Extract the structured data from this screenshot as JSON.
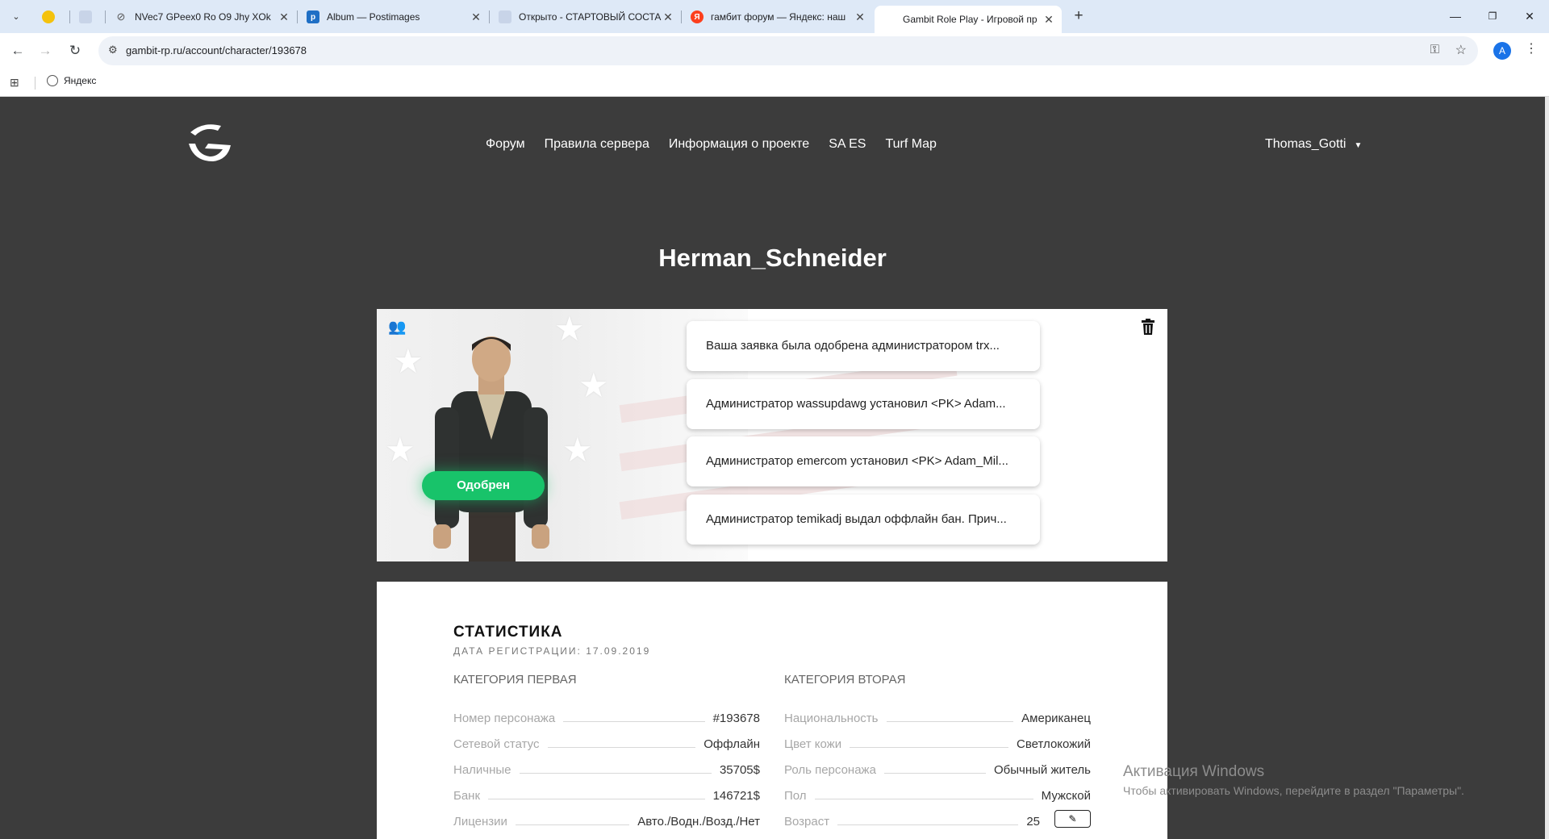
{
  "browser": {
    "tabs": [
      {
        "title": "",
        "icon": "sun-icon"
      },
      {
        "title": "",
        "icon": "cloud-icon"
      },
      {
        "title": "NVec7 GPeex0 Ro O9 Jhy XOk",
        "icon": "link-icon"
      },
      {
        "title": "Album — Postimages",
        "icon": "postimages-icon"
      },
      {
        "title": "Открыто - СТАРТОВЫЙ СОСТА",
        "icon": "forum-icon"
      },
      {
        "title": "гамбит форум — Яндекс: наш",
        "icon": "yandex-icon"
      },
      {
        "title": "Gambit Role Play - Игровой пр",
        "icon": "gambit-icon"
      }
    ],
    "url": "gambit-rp.ru/account/character/193678",
    "profile_initial": "A",
    "bookmark": "Яндекс"
  },
  "site": {
    "nav": [
      "Форум",
      "Правила сервера",
      "Информация о проекте",
      "SA ES",
      "Turf Map"
    ],
    "user": "Thomas_Gotti",
    "character_name": "Herman_Schneider",
    "status": "Одобрен",
    "notices": [
      "Ваша заявка была одобрена администратором trx...",
      "Администратор wassupdawg установил <PK> Adam...",
      "Администратор emercom установил <PK> Adam_Mil...",
      "Администратор temikadj выдал оффлайн бан. Прич..."
    ],
    "stats": {
      "title": "СТАТИСТИКА",
      "registered": "ДАТА РЕГИСТРАЦИИ: 17.09.2019",
      "col1": {
        "heading": "КАТЕГОРИЯ ПЕРВАЯ",
        "rows": [
          {
            "label": "Номер персонажа",
            "value": "#193678"
          },
          {
            "label": "Сетевой статус",
            "value": "Оффлайн"
          },
          {
            "label": "Наличные",
            "value": "35705$"
          },
          {
            "label": "Банк",
            "value": "146721$"
          },
          {
            "label": "Лицензии",
            "value": "Авто./Водн./Возд./Нет"
          }
        ]
      },
      "col2": {
        "heading": "КАТЕГОРИЯ ВТОРАЯ",
        "rows": [
          {
            "label": "Национальность",
            "value": "Американец"
          },
          {
            "label": "Цвет кожи",
            "value": "Светлокожий"
          },
          {
            "label": "Роль персонажа",
            "value": "Обычный житель"
          },
          {
            "label": "Пол",
            "value": "Мужской"
          },
          {
            "label": "Возраст",
            "value": "25"
          }
        ]
      }
    }
  },
  "watermark": {
    "line1": "Активация Windows",
    "line2": "Чтобы активировать Windows, перейдите в раздел \"Параметры\"."
  },
  "colors": {
    "approved": "#18c36a",
    "site_bg": "#3c3c3c",
    "tabbar": "#dee9f7"
  }
}
